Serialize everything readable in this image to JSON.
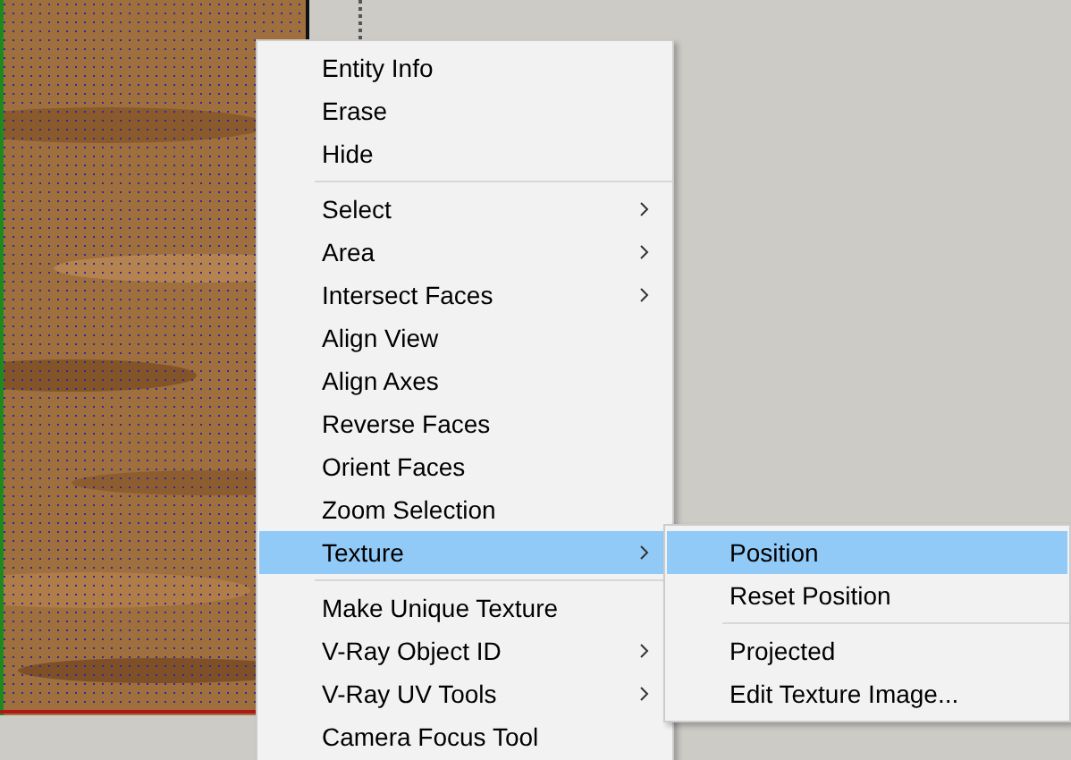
{
  "context_menu": {
    "items": [
      {
        "kind": "item",
        "label": "Entity Info",
        "has_submenu": false,
        "selected": false
      },
      {
        "kind": "item",
        "label": "Erase",
        "has_submenu": false,
        "selected": false
      },
      {
        "kind": "item",
        "label": "Hide",
        "has_submenu": false,
        "selected": false
      },
      {
        "kind": "separator"
      },
      {
        "kind": "item",
        "label": "Select",
        "has_submenu": true,
        "selected": false
      },
      {
        "kind": "item",
        "label": "Area",
        "has_submenu": true,
        "selected": false
      },
      {
        "kind": "item",
        "label": "Intersect Faces",
        "has_submenu": true,
        "selected": false
      },
      {
        "kind": "item",
        "label": "Align View",
        "has_submenu": false,
        "selected": false
      },
      {
        "kind": "item",
        "label": "Align Axes",
        "has_submenu": false,
        "selected": false
      },
      {
        "kind": "item",
        "label": "Reverse Faces",
        "has_submenu": false,
        "selected": false
      },
      {
        "kind": "item",
        "label": "Orient Faces",
        "has_submenu": false,
        "selected": false
      },
      {
        "kind": "item",
        "label": "Zoom Selection",
        "has_submenu": false,
        "selected": false
      },
      {
        "kind": "item",
        "label": "Texture",
        "has_submenu": true,
        "selected": true
      },
      {
        "kind": "separator"
      },
      {
        "kind": "item",
        "label": "Make Unique Texture",
        "has_submenu": false,
        "selected": false
      },
      {
        "kind": "item",
        "label": "V-Ray Object ID",
        "has_submenu": true,
        "selected": false
      },
      {
        "kind": "item",
        "label": "V-Ray UV Tools",
        "has_submenu": true,
        "selected": false
      },
      {
        "kind": "item",
        "label": "Camera Focus Tool",
        "has_submenu": false,
        "selected": false
      }
    ]
  },
  "submenu": {
    "items": [
      {
        "kind": "item",
        "label": "Position",
        "has_submenu": false,
        "selected": true
      },
      {
        "kind": "item",
        "label": "Reset Position",
        "has_submenu": false,
        "selected": false
      },
      {
        "kind": "separator"
      },
      {
        "kind": "item",
        "label": "Projected",
        "has_submenu": false,
        "selected": false
      },
      {
        "kind": "item",
        "label": "Edit Texture Image...",
        "has_submenu": false,
        "selected": false
      }
    ]
  }
}
